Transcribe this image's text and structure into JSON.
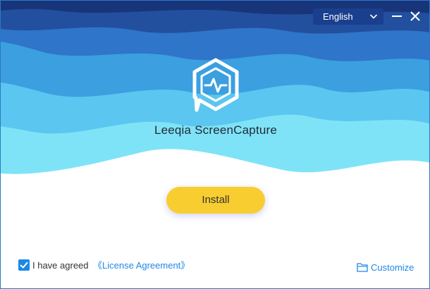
{
  "app": {
    "title": "Leeqia ScreenCapture"
  },
  "language": {
    "selected": "English"
  },
  "window_controls": {
    "minimize_icon": "minimize-icon",
    "close_icon": "close-icon"
  },
  "actions": {
    "install_label": "Install"
  },
  "agreement": {
    "checked": true,
    "text": "I have agreed",
    "link_label": "《License Agreement》"
  },
  "customize": {
    "label": "Customize",
    "icon": "folder-icon"
  },
  "colors": {
    "accent": "#1e88e5",
    "install_button": "#f8cd30",
    "lang_bg": "#1a3f8f",
    "title_text": "#1f2a3a"
  }
}
